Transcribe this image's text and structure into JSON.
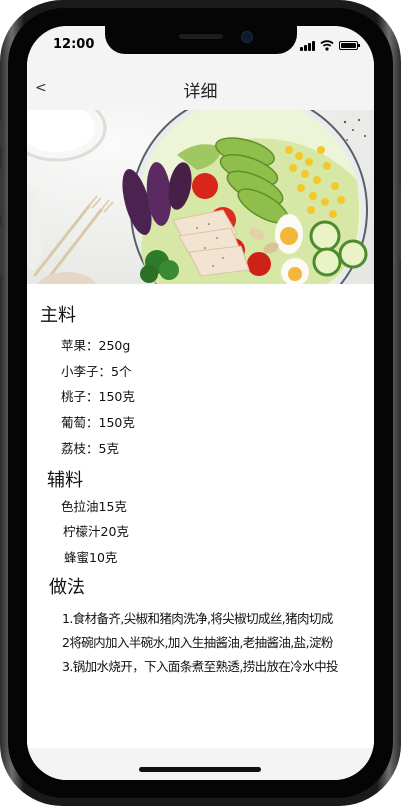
{
  "status_bar": {
    "time": "12:00"
  },
  "nav": {
    "back_label": "<",
    "title": "详细"
  },
  "hero": {
    "icon": "salad-bowl-image"
  },
  "main_ingredients": {
    "heading": "主料",
    "items": [
      "苹果：250g",
      "小李子：5个",
      "桃子：150克",
      "葡萄：150克",
      "荔枝：5克"
    ]
  },
  "side_ingredients": {
    "heading": "辅料",
    "items": [
      "色拉油15克",
      "柠檬汁20克",
      "蜂蜜10克"
    ]
  },
  "method": {
    "heading": "做法",
    "steps": [
      "1.食材备齐,尖椒和猪肉洗净,将尖椒切成丝,猪肉切成",
      "2将碗内加入半碗水,加入生抽酱油,老抽酱油,盐,淀粉",
      "3.锅加水烧开，下入面条煮至熟透,捞出放在冷水中投"
    ]
  }
}
